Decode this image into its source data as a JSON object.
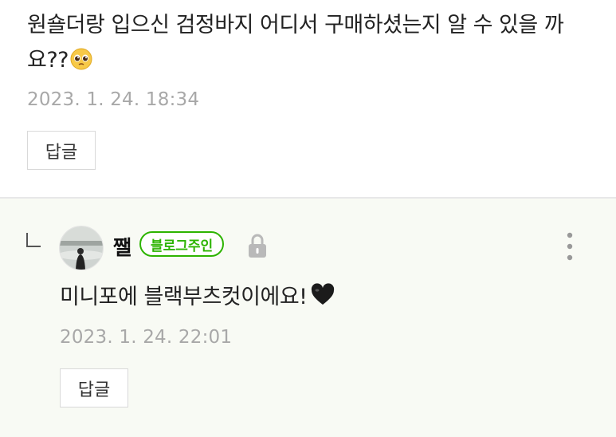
{
  "comment": {
    "text": "원숄더랑 입으신 검정바지 어디서 구매하셨는지 알 수 있을 까요??",
    "emoji_icon": "pleading-face-icon",
    "date": "2023. 1. 24. 18:34",
    "reply_label": "답글"
  },
  "reply": {
    "arrow_icon": "reply-arrow-icon",
    "author": "쨀",
    "owner_badge": "블로그주인",
    "lock_icon": "lock-icon",
    "more_icon": "more-vertical-icon",
    "text": "미니포에 블랙부츠컷이에요!",
    "heart_icon": "black-heart-icon",
    "date": "2023. 1. 24. 22:01",
    "reply_label": "답글"
  },
  "colors": {
    "accent_green": "#2db400",
    "reply_background": "#f8faf4",
    "date_gray": "#a8a8a8",
    "divider": "#e8e8e8"
  }
}
